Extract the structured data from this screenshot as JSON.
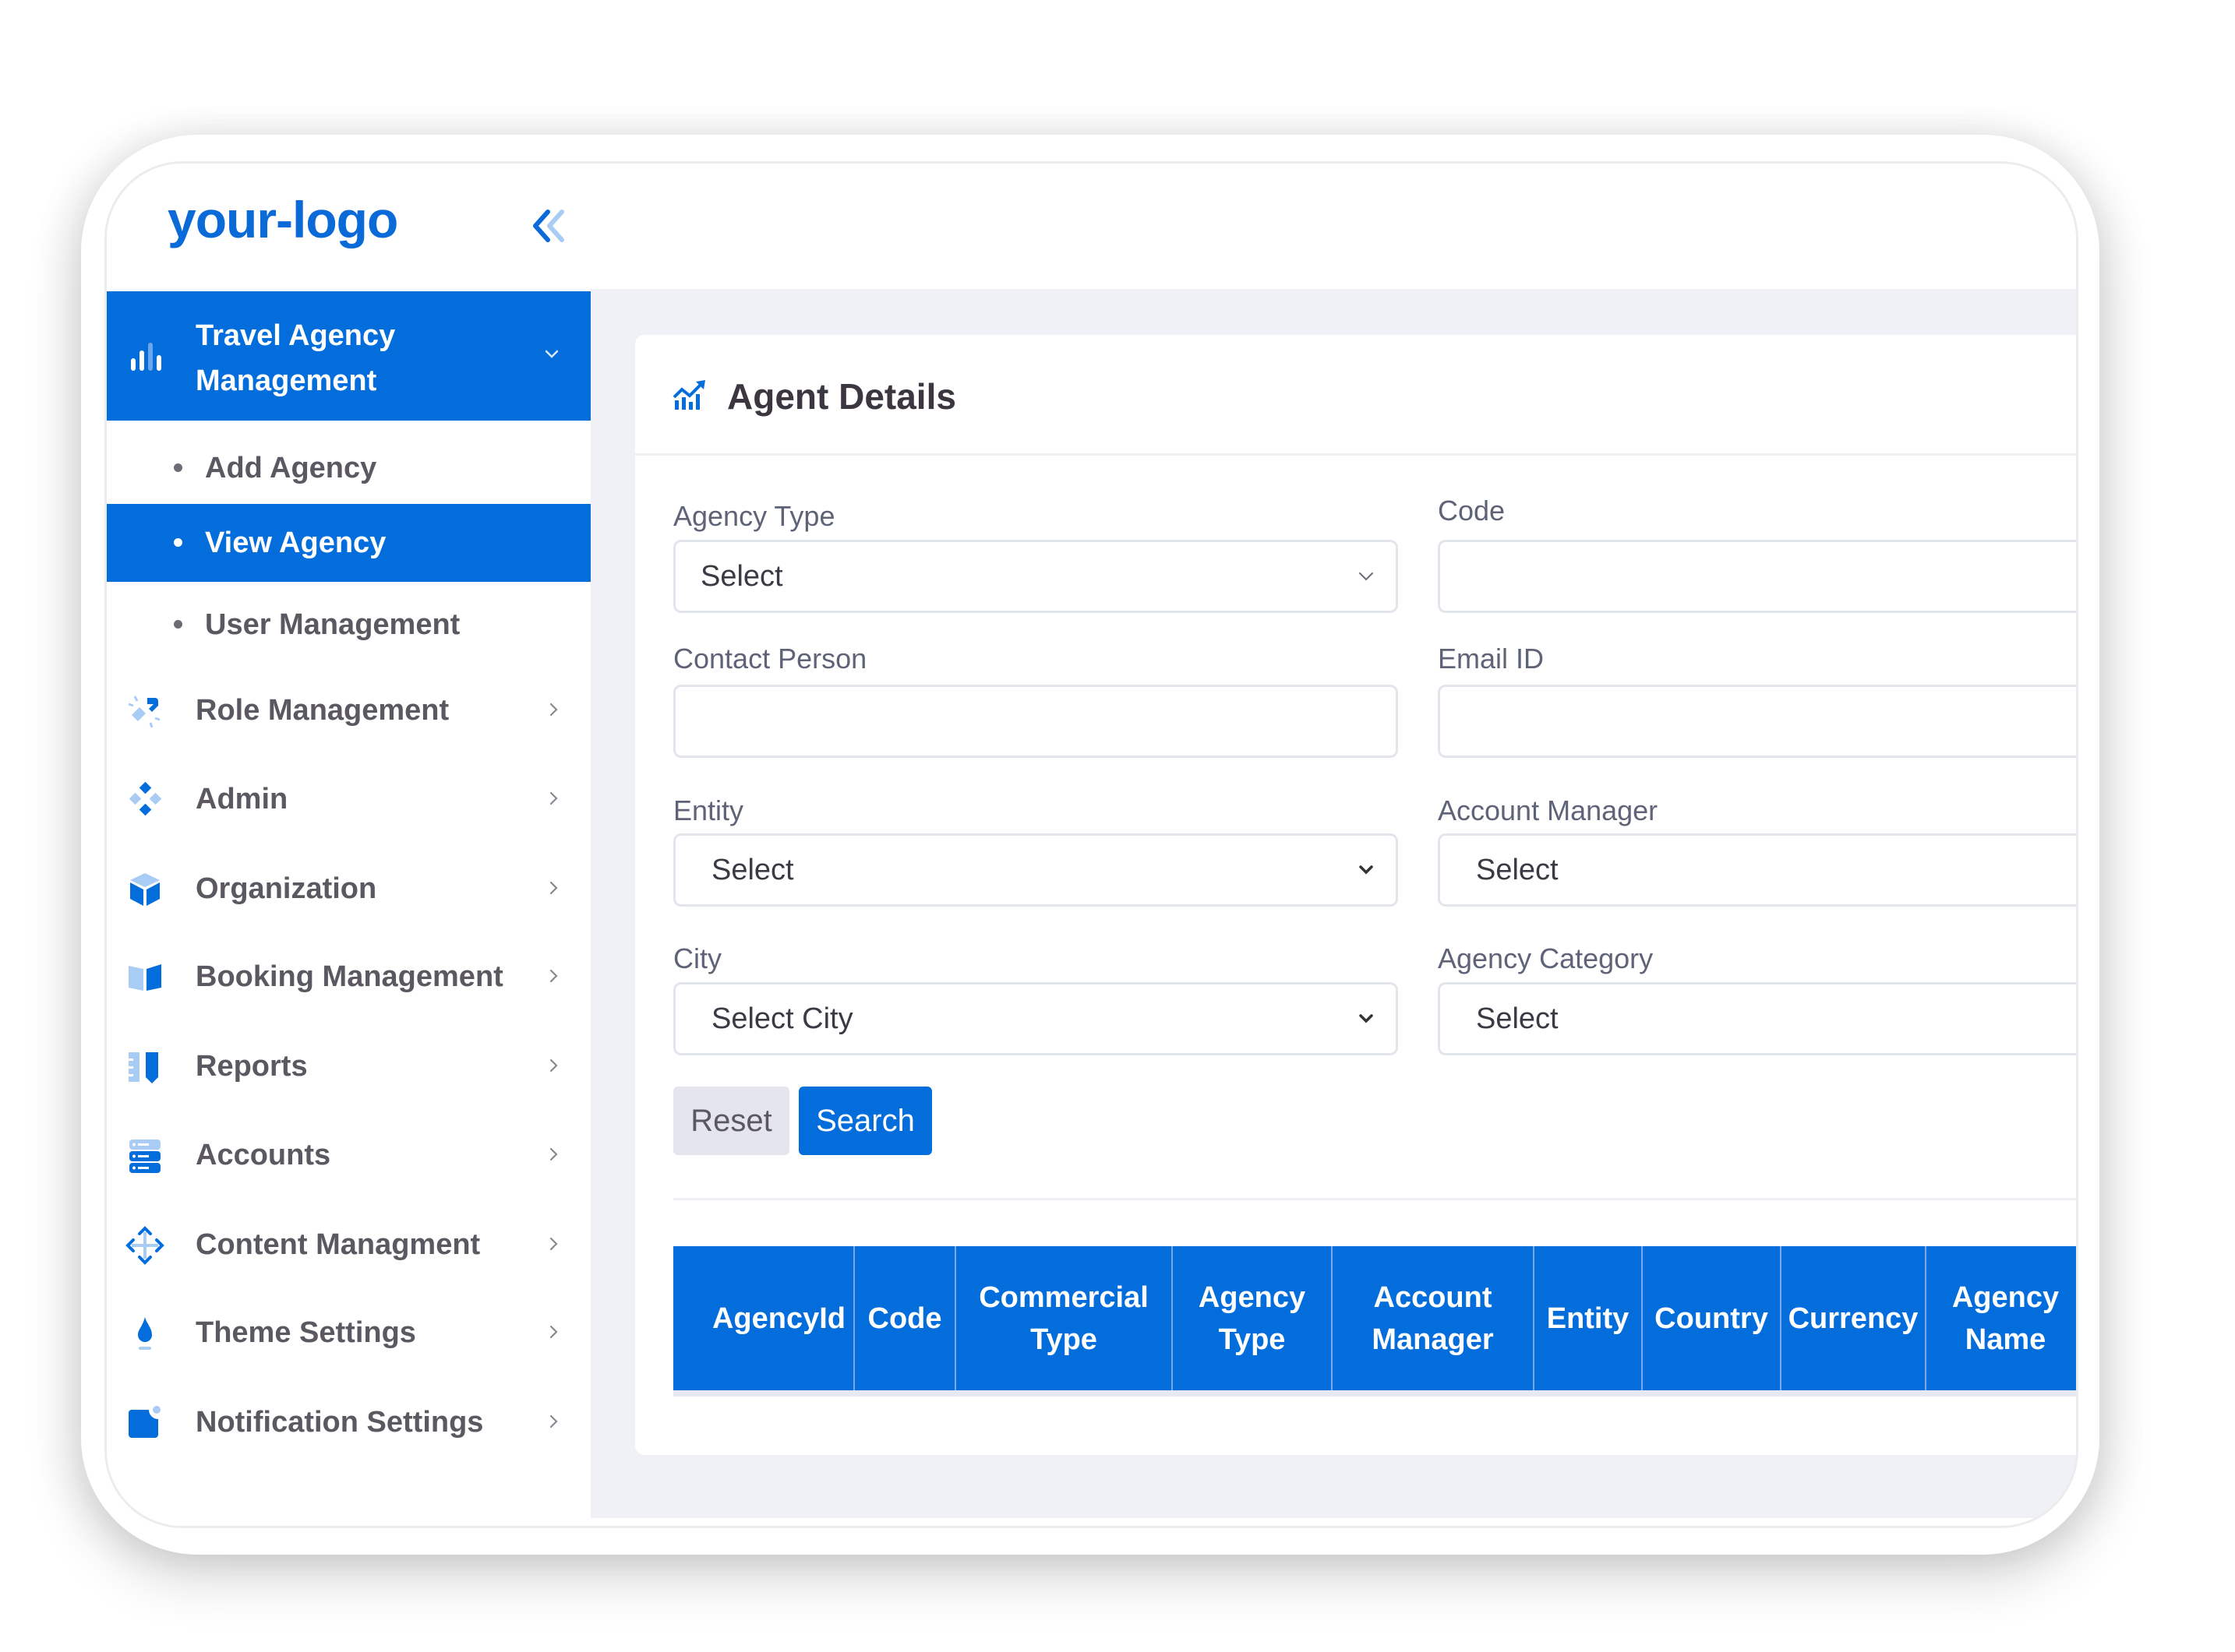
{
  "app": {
    "logo": "your-logo",
    "collapse_icon": "double-chevron-left-icon"
  },
  "sidebar": {
    "active_group": {
      "label_line1": "Travel Agency",
      "label_line2": "Management",
      "icon": "bar-chart-icon",
      "expanded": true,
      "children": [
        {
          "label": "Add Agency",
          "active": false
        },
        {
          "label": "View Agency",
          "active": true
        },
        {
          "label": "User Management",
          "active": false
        }
      ]
    },
    "items": [
      {
        "label": "Role Management",
        "icon": "role-management-icon"
      },
      {
        "label": "Admin",
        "icon": "admin-diamonds-icon"
      },
      {
        "label": "Organization",
        "icon": "cube-icon"
      },
      {
        "label": "Booking Management",
        "icon": "book-open-icon"
      },
      {
        "label": "Reports",
        "icon": "reports-ruler-pen-icon"
      },
      {
        "label": "Accounts",
        "icon": "server-stack-icon"
      },
      {
        "label": "Content Managment",
        "icon": "move-arrows-icon"
      },
      {
        "label": "Theme Settings",
        "icon": "flame-drop-icon"
      },
      {
        "label": "Notification Settings",
        "icon": "notification-badge-icon"
      }
    ]
  },
  "main": {
    "title": "Agent Details",
    "title_icon": "trend-chart-icon",
    "form": {
      "agency_type": {
        "label": "Agency Type",
        "value": "Select"
      },
      "code": {
        "label": "Code",
        "value": ""
      },
      "contact_person": {
        "label": "Contact Person",
        "value": ""
      },
      "email_id": {
        "label": "Email ID",
        "value": ""
      },
      "entity": {
        "label": "Entity",
        "value": "Select"
      },
      "account_manager": {
        "label": "Account Manager",
        "value": "Select"
      },
      "city": {
        "label": "City",
        "value": "Select City"
      },
      "agency_category": {
        "label": "Agency Category",
        "value": "Select"
      }
    },
    "buttons": {
      "reset": "Reset",
      "search": "Search"
    },
    "table": {
      "columns": [
        "AgencyId",
        "Code",
        "Commercial Type",
        "Agency Type",
        "Account Manager",
        "Entity",
        "Country",
        "Currency",
        "Agency Name"
      ],
      "rows": []
    }
  },
  "colors": {
    "primary": "#046ddc",
    "primary_light": "#a9ccf5",
    "content_bg": "#f0f1f6",
    "text_muted": "#5c5862"
  }
}
